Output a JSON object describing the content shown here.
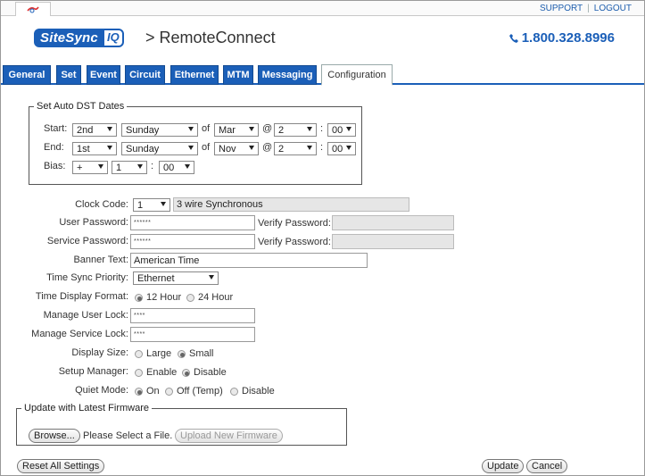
{
  "top_links": {
    "support": "SUPPORT",
    "separator": "|",
    "logout": "LOGOUT"
  },
  "header": {
    "logo_main": "SiteSync",
    "logo_iq": "IQ",
    "app_title": "> RemoteConnect",
    "phone": "1.800.328.8996"
  },
  "tabs": [
    {
      "label": "General"
    },
    {
      "label": "Set"
    },
    {
      "label": "Event"
    },
    {
      "label": "Circuit"
    },
    {
      "label": "Ethernet"
    },
    {
      "label": "MTM"
    },
    {
      "label": "Messaging"
    },
    {
      "label": "Configuration",
      "active": true
    }
  ],
  "dst": {
    "legend": "Set Auto DST Dates",
    "start_label": "Start:",
    "end_label": "End:",
    "bias_label": "Bias:",
    "of": "of",
    "at": "@",
    "colon": ":",
    "start": {
      "week": "2nd",
      "day": "Sunday",
      "month": "Mar",
      "hour": "2",
      "minute": "00"
    },
    "end": {
      "week": "1st",
      "day": "Sunday",
      "month": "Nov",
      "hour": "2",
      "minute": "00"
    },
    "bias": {
      "sign": "+",
      "hours": "1",
      "minutes": "00"
    }
  },
  "form": {
    "clock_code_label": "Clock Code:",
    "clock_code_value": "1",
    "clock_code_desc": "3 wire Synchronous",
    "user_password_label": "User Password:",
    "user_password_value": "******",
    "verify_password_label": "Verify Password:",
    "service_password_label": "Service Password:",
    "service_password_value": "******",
    "banner_text_label": "Banner Text:",
    "banner_text_value": "American Time",
    "time_sync_label": "Time Sync Priority:",
    "time_sync_value": "Ethernet",
    "time_format_label": "Time Display Format:",
    "time_format_12": "12 Hour",
    "time_format_24": "24 Hour",
    "manage_user_lock_label": "Manage User Lock:",
    "manage_user_lock_value": "****",
    "manage_service_lock_label": "Manage Service Lock:",
    "manage_service_lock_value": "****",
    "display_size_label": "Display Size:",
    "display_size_large": "Large",
    "display_size_small": "Small",
    "setup_manager_label": "Setup Manager:",
    "setup_manager_enable": "Enable",
    "setup_manager_disable": "Disable",
    "quiet_mode_label": "Quiet Mode:",
    "quiet_on": "On",
    "quiet_off_temp": "Off (Temp)",
    "quiet_disable": "Disable"
  },
  "firmware": {
    "legend": "Update with Latest Firmware",
    "browse": "Browse...",
    "status": "Please Select a File.",
    "upload": "Upload New Firmware"
  },
  "actions": {
    "reset": "Reset All Settings",
    "update": "Update",
    "cancel": "Cancel"
  },
  "colors": {
    "brand_blue": "#1b5fb8"
  }
}
